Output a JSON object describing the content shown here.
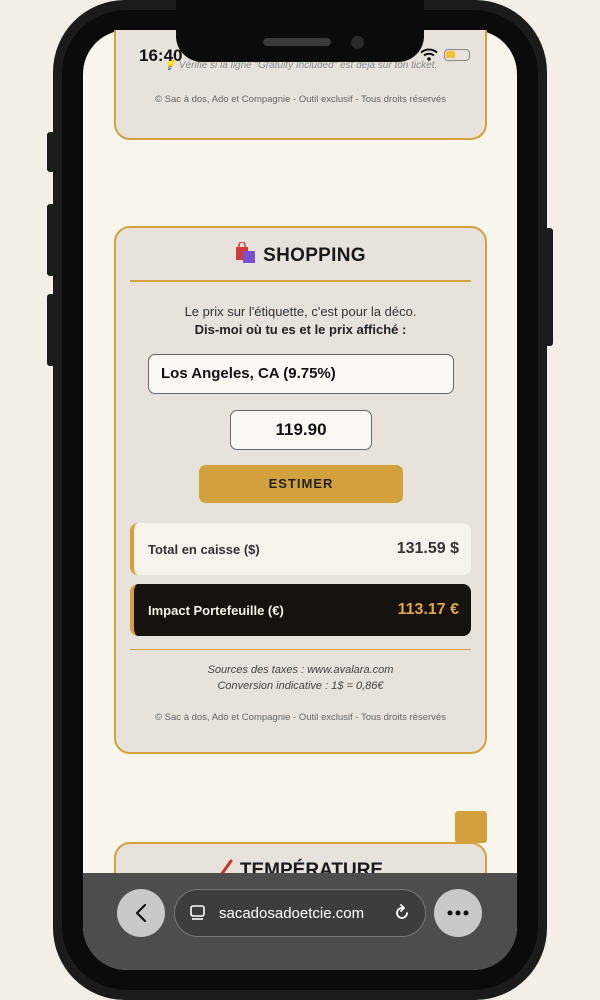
{
  "status_bar": {
    "time": "16:40"
  },
  "previous_section": {
    "hint": "💡 Vérifie si la ligne \"Gratuity Included\" est déjà sur ton ticket.",
    "footer": "© Sac à dos, Ado et Compagnie - Outil exclusif - Tous droits réservés"
  },
  "shopping": {
    "title": "SHOPPING",
    "intro_line1": "Le prix sur l'étiquette, c'est pour la déco.",
    "intro_line2": "Dis-moi où tu es et le prix affiché :",
    "city_selected": "Los Angeles, CA (9.75%)",
    "price_value": "119.90",
    "estimate_label": "ESTIMER",
    "total_label": "Total en caisse ($)",
    "total_value": "131.59 $",
    "impact_label": "Impact Portefeuille (€)",
    "impact_value": "113.17 €",
    "sources_line1": "Sources des taxes : www.avalara.com",
    "sources_line2": "Conversion indicative : 1$ = 0,86€",
    "footer": "© Sac à dos, Ado et Compagnie - Outil exclusif - Tous droits réservés"
  },
  "next_section": {
    "title": "TEMPÉRATURE"
  },
  "browser": {
    "url": "sacadosadoetcie.com",
    "back_icon": "chevron-left-icon",
    "more_icon": "more-dots-icon"
  },
  "colors": {
    "accent": "#d2a13e",
    "card_bg": "#e7e3dc",
    "page_bg": "#f8f5ec",
    "impact_bg": "#16120d",
    "impact_value": "#e2a847"
  }
}
